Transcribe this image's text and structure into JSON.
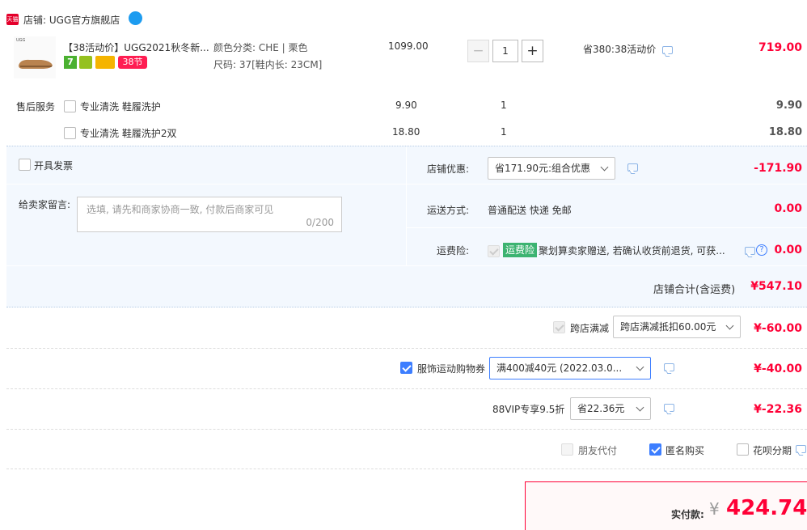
{
  "shop": {
    "badge": "天猫",
    "label": "店铺: UGG官方旗舰店"
  },
  "item": {
    "brand_mark": "UGG",
    "title": "【38活动价】UGG2021秋冬新...",
    "sku_color": "颜色分类: CHE | 栗色",
    "sku_size": "尺码: 37[鞋内长: 23CM]",
    "unit_price": "1099.00",
    "quantity": "1",
    "badge_7": "7",
    "badge_38": "38节",
    "savings": "省380:38活动价",
    "subtotal": "719.00"
  },
  "after_sale": {
    "label": "售后服务",
    "services": [
      {
        "name": "专业清洗 鞋履洗护",
        "price": "9.90",
        "qty": "1",
        "total": "9.90"
      },
      {
        "name": "专业清洗 鞋履洗护2双",
        "price": "18.80",
        "qty": "1",
        "total": "18.80"
      }
    ]
  },
  "invoice": {
    "label": "开具发票"
  },
  "message": {
    "label": "给卖家留言:",
    "placeholder": "选填, 请先和商家协商一致, 付款后商家可见",
    "counter": "0/200"
  },
  "shop_discount": {
    "label": "店铺优惠:",
    "selected": "省171.90元:组合优惠",
    "amount": "-171.90"
  },
  "shipping": {
    "label": "运送方式:",
    "value": "普通配送 快递 免邮",
    "amount": "0.00"
  },
  "insurance": {
    "label": "运费险:",
    "tag": "运费险",
    "desc": "聚划算卖家赠送, 若确认收货前退货, 可获...",
    "amount": "0.00"
  },
  "shop_total": {
    "label": "店铺合计(含运费)",
    "amount": "¥547.10"
  },
  "cross_store": {
    "label": "跨店满减",
    "selected": "跨店满减抵扣60.00元",
    "amount": "¥-60.00"
  },
  "coupon": {
    "label": "服饰运动购物券",
    "selected": "满400减40元 (2022.03.0...",
    "amount": "¥-40.00"
  },
  "vip": {
    "label": "88VIP专享9.5折",
    "selected": "省22.36元",
    "amount": "¥-22.36"
  },
  "options": {
    "friend_pay": "朋友代付",
    "anonymous": "匿名购买",
    "installment": "花呗分期"
  },
  "final": {
    "label": "实付款:",
    "currency": "¥",
    "amount": "424.74"
  },
  "colors": {
    "accent_red": "#ff0036",
    "accent_blue": "#3d7eff",
    "panel_bg": "#f3f8fe"
  }
}
